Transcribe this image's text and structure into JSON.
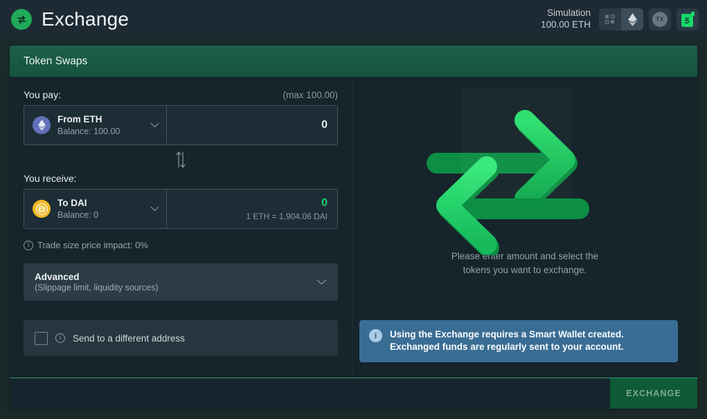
{
  "app": {
    "title": "Exchange",
    "logo_icon": "swap-arrows-icon"
  },
  "topbar": {
    "simulation_label": "Simulation",
    "simulation_balance": "100.00 ETH",
    "network_icon": "network-nodes-icon",
    "chain_icon": "ethereum-diamond-icon",
    "tx_label": "TX",
    "gas_value": "5",
    "gas_icon": "gas-can-icon"
  },
  "card": {
    "title": "Token Swaps"
  },
  "pay": {
    "label": "You pay:",
    "max": "(max 100.00)",
    "token_name": "From ETH",
    "token_balance": "Balance: 100.00",
    "token_icon": "ethereum-icon",
    "chevron_icon": "chevron-down-icon",
    "amount": "0",
    "amount_placeholder": "0"
  },
  "swap": {
    "icon": "swap-vertical-icon"
  },
  "receive": {
    "label": "You receive:",
    "token_name": "To DAI",
    "token_balance": "Balance: 0",
    "token_icon": "dai-icon",
    "chevron_icon": "chevron-down-icon",
    "amount": "0",
    "rate": "1 ETH = 1,904.06 DAI"
  },
  "impact": {
    "icon": "info-icon",
    "text": "Trade size price impact: 0%"
  },
  "advanced": {
    "title": "Advanced",
    "subtitle": "(Slippage limit, liquidity sources)",
    "chevron_icon": "chevron-down-icon"
  },
  "send_address": {
    "checkbox_icon": "checkbox-unchecked-icon",
    "info_icon": "info-icon",
    "label": "Send to a different address"
  },
  "right_panel": {
    "illustration_icon": "exchange-arrows-illustration",
    "hint_line1": "Please enter amount and select the",
    "hint_line2": "tokens you want to exchange.",
    "notice_icon": "info-icon",
    "notice_text": "Using the Exchange requires a Smart Wallet created. Exchanged funds are regularly sent to your account."
  },
  "footer": {
    "exchange_label": "EXCHANGE"
  },
  "colors": {
    "accent_green": "#1fd173",
    "header_green": "#1b6049",
    "notice_blue": "#3a6d94",
    "eth_purple": "#6271ba",
    "dai_yellow": "#f2b824",
    "page_bg": "#1b2a29",
    "card_bg": "#16242b"
  }
}
